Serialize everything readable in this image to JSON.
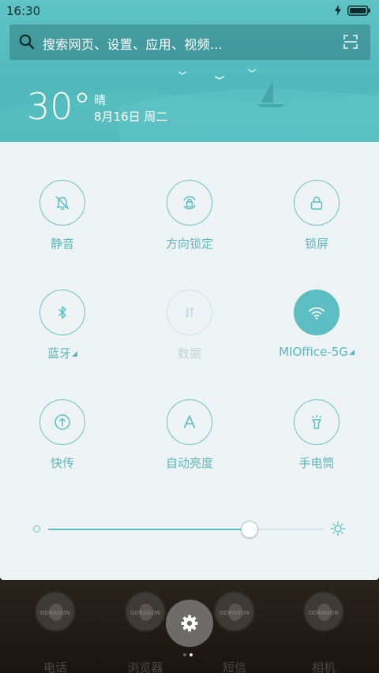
{
  "status_bar": {
    "time": "16:30"
  },
  "search": {
    "placeholder": "搜索网页、设置、应用、视频..."
  },
  "weather": {
    "temperature": "30°",
    "condition": "晴",
    "date": "8月16日 周二"
  },
  "quick_toggles": [
    {
      "label": "静音",
      "icon": "bell-off-icon",
      "state": "off"
    },
    {
      "label": "方向锁定",
      "icon": "rotation-lock-icon",
      "state": "off"
    },
    {
      "label": "锁屏",
      "icon": "lock-icon",
      "state": "off"
    },
    {
      "label": "蓝牙",
      "icon": "bluetooth-icon",
      "state": "off"
    },
    {
      "label": "数据",
      "icon": "mobile-data-icon",
      "state": "disabled"
    },
    {
      "label": "MIOffice-5G",
      "icon": "wifi-icon",
      "state": "on"
    },
    {
      "label": "快传",
      "icon": "quick-transfer-icon",
      "state": "off"
    },
    {
      "label": "自动亮度",
      "icon": "auto-brightness-icon",
      "state": "off"
    },
    {
      "label": "手电筒",
      "icon": "flashlight-icon",
      "state": "off"
    }
  ],
  "brightness": {
    "level": 0.73
  },
  "dock": {
    "apps": [
      {
        "label": "电话",
        "badge": "GDRAGON"
      },
      {
        "label": "浏览器",
        "badge": "GDRAGON"
      },
      {
        "label": "短信",
        "badge": "GDRAGON"
      },
      {
        "label": "相机",
        "badge": "GDRAGON"
      }
    ],
    "current_page": 2,
    "page_count": 2
  },
  "colors": {
    "header": "#52babd",
    "panel_bg": "#eef3f5",
    "accent": "#5cbec3",
    "label": "#5cb7bc",
    "disabled": "#bfd6d8"
  }
}
